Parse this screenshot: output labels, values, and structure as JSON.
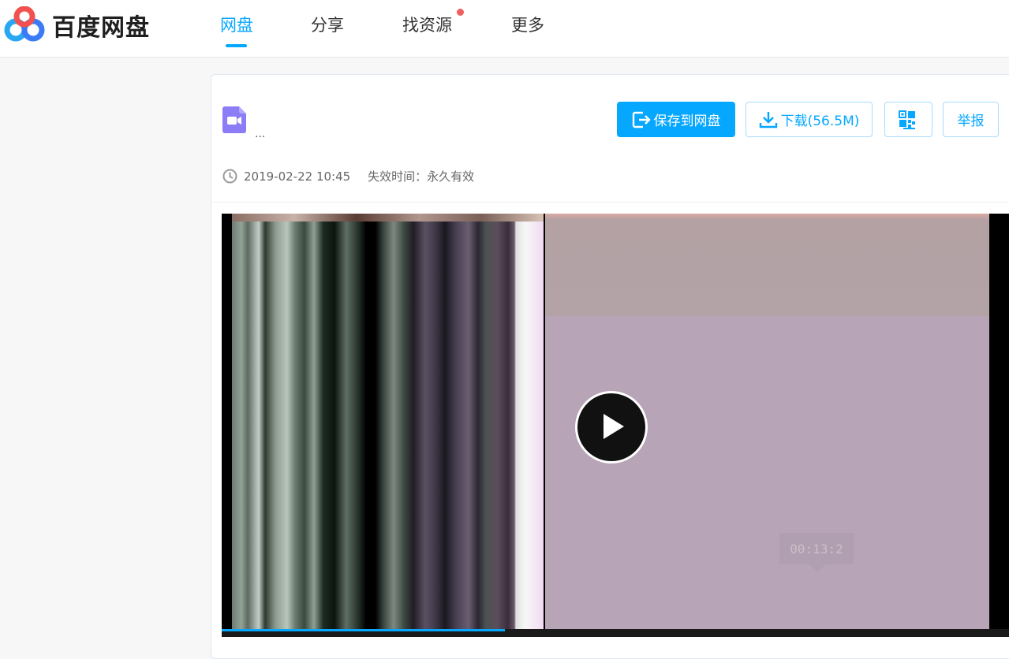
{
  "header": {
    "brand": "百度网盘",
    "nav": [
      {
        "label": "网盘",
        "active": true
      },
      {
        "label": "分享",
        "active": false
      },
      {
        "label": "找资源",
        "active": false,
        "has_dot": true
      },
      {
        "label": "更多",
        "active": false
      }
    ]
  },
  "file": {
    "name_ellipsis": "...",
    "icon": "video-file-icon",
    "date": "2019-02-22 10:45",
    "expiry": "失效时间：永久有效"
  },
  "actions": {
    "save_label": "保存到网盘",
    "download_label": "下载(56.5M)",
    "qr_icon": "qr-code-icon",
    "report_label": "举报"
  },
  "player": {
    "hover_time": "00:13:2",
    "progress_fraction": 0.36
  },
  "colors": {
    "accent": "#06a7ff",
    "notify_dot": "#f25d5d"
  }
}
